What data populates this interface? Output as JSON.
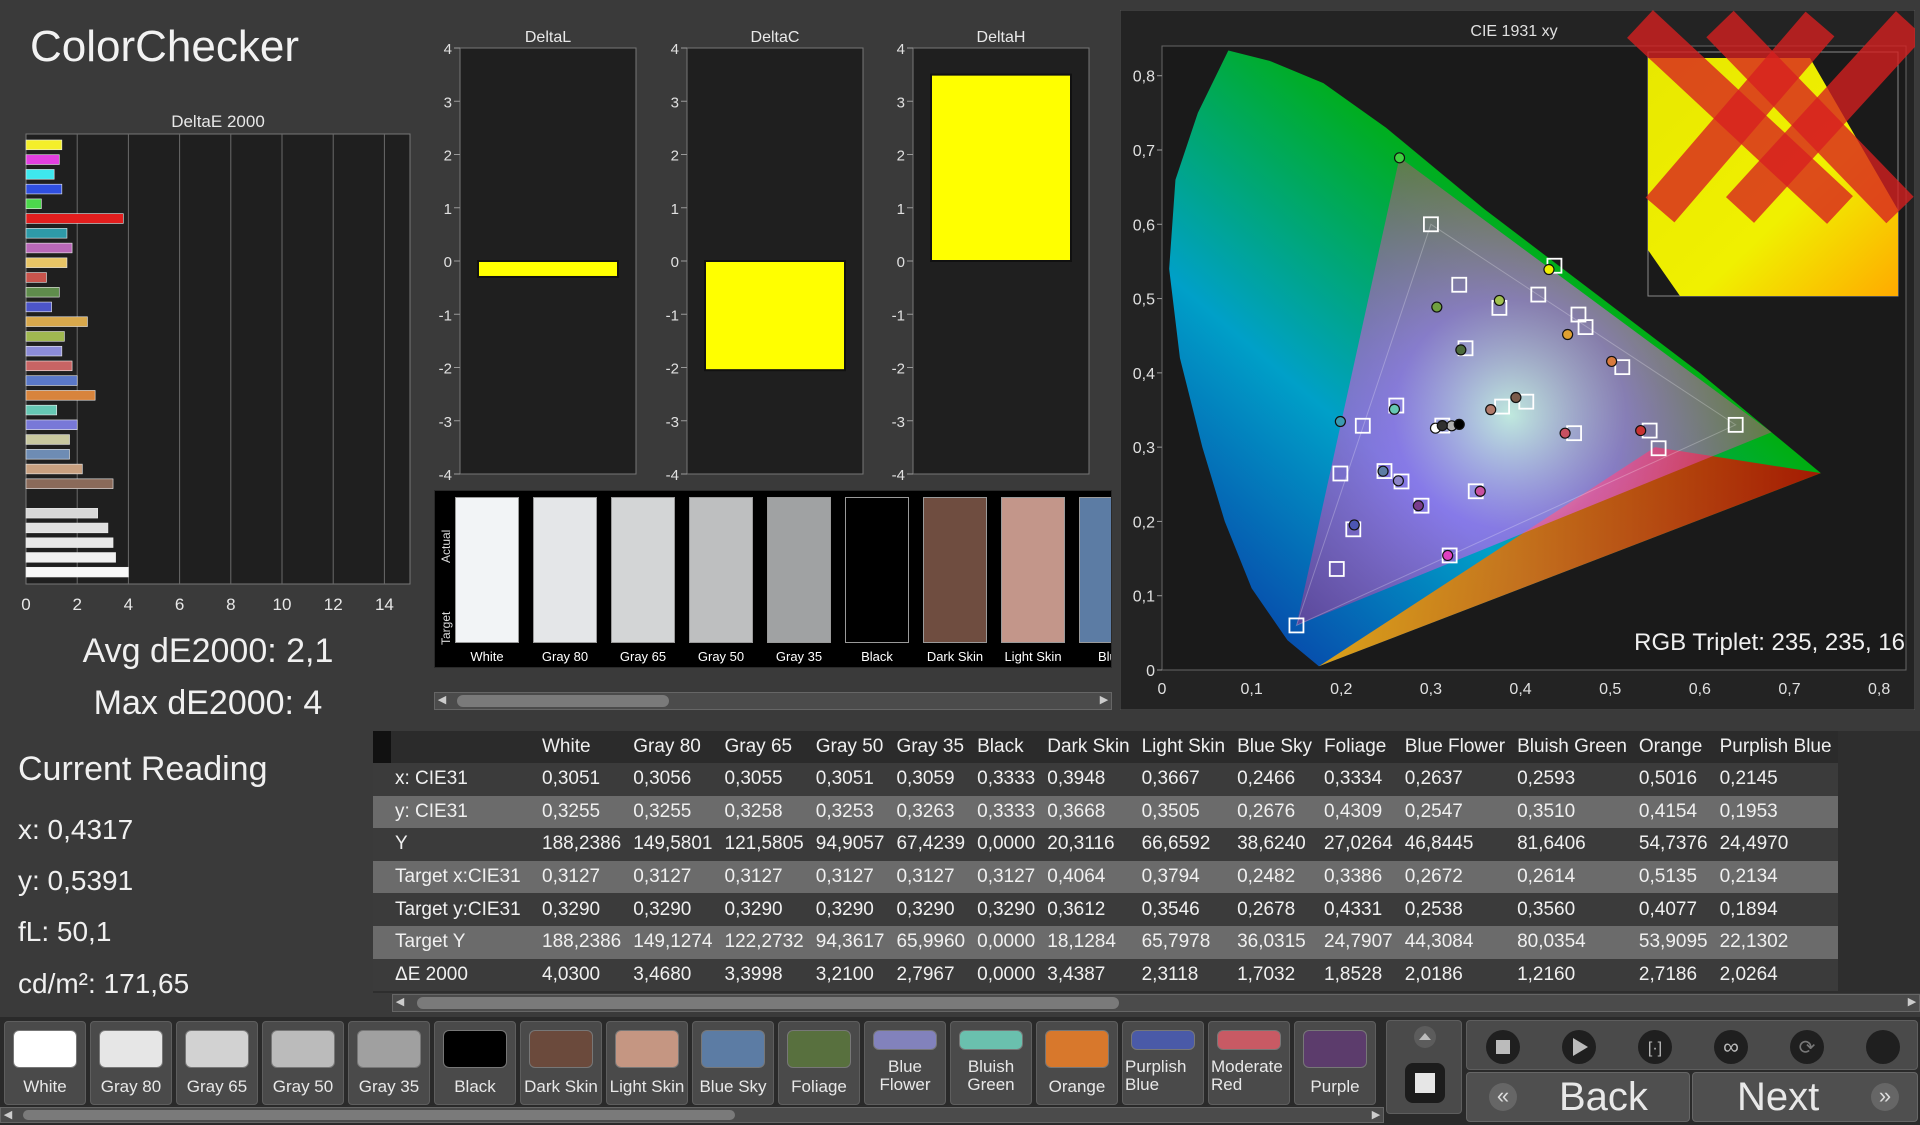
{
  "app": {
    "title": "ColorChecker"
  },
  "deltae_chart": {
    "title": "DeltaE 2000",
    "ticks": [
      "0",
      "2",
      "4",
      "6",
      "8",
      "10",
      "12",
      "14"
    ],
    "xlim": [
      0,
      15
    ],
    "bars": [
      {
        "value": 1.4,
        "color": "#f4ef2a"
      },
      {
        "value": 1.3,
        "color": "#e33fe0"
      },
      {
        "value": 1.1,
        "color": "#3ee8ee"
      },
      {
        "value": 1.4,
        "color": "#2f4fe0"
      },
      {
        "value": 0.6,
        "color": "#4cd84c"
      },
      {
        "value": 3.8,
        "color": "#e31e1e"
      },
      {
        "value": 1.6,
        "color": "#2e9aa8"
      },
      {
        "value": 1.8,
        "color": "#b968b8"
      },
      {
        "value": 1.6,
        "color": "#e8c566"
      },
      {
        "value": 0.8,
        "color": "#c8544c"
      },
      {
        "value": 1.3,
        "color": "#5f8c4c"
      },
      {
        "value": 1.0,
        "color": "#4c55c8"
      },
      {
        "value": 2.4,
        "color": "#d8a84c"
      },
      {
        "value": 1.5,
        "color": "#a0b850"
      },
      {
        "value": 1.4,
        "color": "#8c8cd8"
      },
      {
        "value": 1.8,
        "color": "#c86464"
      },
      {
        "value": 2.0,
        "color": "#5a78c8"
      },
      {
        "value": 2.7,
        "color": "#d8843c"
      },
      {
        "value": 1.2,
        "color": "#66c8b4"
      },
      {
        "value": 2.0,
        "color": "#7878d8"
      },
      {
        "value": 1.7,
        "color": "#c8c8a0"
      },
      {
        "value": 1.7,
        "color": "#6e8cb4"
      },
      {
        "value": 2.2,
        "color": "#c8a080"
      },
      {
        "value": 3.4,
        "color": "#8a6a5a"
      },
      {
        "value": 0.0,
        "color": "#000000"
      },
      {
        "value": 2.8,
        "color": "#d8d8d8"
      },
      {
        "value": 3.2,
        "color": "#e0e0e0"
      },
      {
        "value": 3.4,
        "color": "#e8e8e8"
      },
      {
        "value": 3.5,
        "color": "#f0f0f0"
      },
      {
        "value": 4.0,
        "color": "#f8f8f8"
      }
    ]
  },
  "summary": {
    "avg": "Avg dE2000: 2,1",
    "max": "Max dE2000: 4"
  },
  "current_reading": {
    "title": "Current Reading",
    "x": "x: 0,4317",
    "y": "y: 0,5391",
    "fl": "fL: 50,1",
    "cd": "cd/m²: 171,65"
  },
  "delta_charts": {
    "ticks": [
      "4",
      "3",
      "2",
      "1",
      "0",
      "-1",
      "-2",
      "-3",
      "-4"
    ],
    "ylim": [
      -4,
      4
    ],
    "charts": [
      {
        "title": "DeltaL",
        "value": -0.3
      },
      {
        "title": "DeltaC",
        "value": -2.05
      },
      {
        "title": "DeltaH",
        "value": 3.5
      }
    ],
    "bar_color": "#ffff00"
  },
  "swatch_strip": {
    "actual_label": "Actual",
    "target_label": "Target",
    "items": [
      {
        "name": "White",
        "color": "#f2f4f6"
      },
      {
        "name": "Gray 80",
        "color": "#e4e6e8"
      },
      {
        "name": "Gray 65",
        "color": "#d3d5d6"
      },
      {
        "name": "Gray 50",
        "color": "#bebfc0"
      },
      {
        "name": "Gray 35",
        "color": "#a0a2a3"
      },
      {
        "name": "Black",
        "color": "#000000"
      },
      {
        "name": "Dark Skin",
        "color": "#6f4d40"
      },
      {
        "name": "Light Skin",
        "color": "#c3968a"
      },
      {
        "name": "Blue",
        "color": "#5c7ca4"
      }
    ]
  },
  "cie_chart": {
    "title": "CIE 1931 xy",
    "x_ticks": [
      "0",
      "0,1",
      "0,2",
      "0,3",
      "0,4",
      "0,5",
      "0,6",
      "0,7",
      "0,8"
    ],
    "y_ticks": [
      "0",
      "0,1",
      "0,2",
      "0,3",
      "0,4",
      "0,5",
      "0,6",
      "0,7",
      "0,8"
    ],
    "xlim": [
      0,
      0.83
    ],
    "ylim": [
      0,
      0.84
    ],
    "gamut_target": [
      [
        0.64,
        0.33
      ],
      [
        0.3,
        0.6
      ],
      [
        0.15,
        0.06
      ]
    ],
    "gamut_actual": [
      [
        0.68,
        0.32
      ],
      [
        0.265,
        0.69
      ],
      [
        0.15,
        0.06
      ]
    ],
    "targets": [
      [
        0.3127,
        0.329
      ],
      [
        0.4064,
        0.3612
      ],
      [
        0.3794,
        0.3546
      ],
      [
        0.2482,
        0.2678
      ],
      [
        0.3386,
        0.4331
      ],
      [
        0.2672,
        0.2538
      ],
      [
        0.2614,
        0.356
      ],
      [
        0.5135,
        0.4077
      ],
      [
        0.2134,
        0.1894
      ],
      [
        0.4597,
        0.3188
      ],
      [
        0.3764,
        0.4875
      ],
      [
        0.4725,
        0.4616
      ],
      [
        0.195,
        0.136
      ],
      [
        0.3316,
        0.5186
      ],
      [
        0.544,
        0.3223
      ],
      [
        0.4646,
        0.4785
      ],
      [
        0.35,
        0.2406
      ],
      [
        0.199,
        0.2645
      ],
      [
        0.64,
        0.33
      ],
      [
        0.3,
        0.6
      ],
      [
        0.15,
        0.06
      ],
      [
        0.224,
        0.3288
      ],
      [
        0.3209,
        0.1542
      ],
      [
        0.4198,
        0.5054
      ],
      [
        0.2895,
        0.2212
      ],
      [
        0.4378,
        0.5442
      ],
      [
        0.554,
        0.2985
      ]
    ],
    "actuals": [
      [
        0.3051,
        0.3255,
        "#ffffff"
      ],
      [
        0.3948,
        0.3668,
        "#7a5a4a"
      ],
      [
        0.3667,
        0.3505,
        "#b07a6a"
      ],
      [
        0.2466,
        0.2676,
        "#5c7ca4"
      ],
      [
        0.3334,
        0.4309,
        "#4c6a3c"
      ],
      [
        0.2637,
        0.2547,
        "#8c84c8"
      ],
      [
        0.2593,
        0.351,
        "#66c8b4"
      ],
      [
        0.5016,
        0.4154,
        "#d87a3c"
      ],
      [
        0.2145,
        0.1953,
        "#4c56b4"
      ],
      [
        0.4497,
        0.3188,
        "#c85060"
      ],
      [
        0.3764,
        0.4975,
        "#a0c050"
      ],
      [
        0.4525,
        0.4516,
        "#e0a030"
      ],
      [
        0.286,
        0.2212,
        "#7a3c8c"
      ],
      [
        0.3066,
        0.4886,
        "#70a040"
      ],
      [
        0.534,
        0.3223,
        "#c83232"
      ],
      [
        0.3232,
        0.3287,
        "#b0b0b0"
      ],
      [
        0.355,
        0.2406,
        "#c850a0"
      ],
      [
        0.199,
        0.3345,
        "#3a9ab0"
      ],
      [
        0.3127,
        0.329,
        "#303030"
      ],
      [
        0.3316,
        0.3306,
        "#000000"
      ],
      [
        0.3187,
        0.1542,
        "#e040c0"
      ],
      [
        0.265,
        0.6895,
        "#40d040"
      ],
      [
        0.4317,
        0.5391,
        "#f0f000"
      ]
    ],
    "rgb_triplet": "RGB Triplet: 235, 235, 16",
    "inset_color": "#f0f000"
  },
  "table": {
    "columns": [
      "",
      "White",
      "Gray 80",
      "Gray 65",
      "Gray 50",
      "Gray 35",
      "Black",
      "Dark Skin",
      "Light Skin",
      "Blue Sky",
      "Foliage",
      "Blue Flower",
      "Bluish Green",
      "Orange",
      "Purplish Blue"
    ],
    "rows": [
      {
        "label": "x: CIE31",
        "cells": [
          "0,3051",
          "0,3056",
          "0,3055",
          "0,3051",
          "0,3059",
          "0,3333",
          "0,3948",
          "0,3667",
          "0,2466",
          "0,3334",
          "0,2637",
          "0,2593",
          "0,5016",
          "0,2145"
        ]
      },
      {
        "label": "y: CIE31",
        "cells": [
          "0,3255",
          "0,3255",
          "0,3258",
          "0,3253",
          "0,3263",
          "0,3333",
          "0,3668",
          "0,3505",
          "0,2676",
          "0,4309",
          "0,2547",
          "0,3510",
          "0,4154",
          "0,1953"
        ]
      },
      {
        "label": "Y",
        "cells": [
          "188,2386",
          "149,5801",
          "121,5805",
          "94,9057",
          "67,4239",
          "0,0000",
          "20,3116",
          "66,6592",
          "38,6240",
          "27,0264",
          "46,8445",
          "81,6406",
          "54,7376",
          "24,4970"
        ]
      },
      {
        "label": "Target x:CIE31",
        "cells": [
          "0,3127",
          "0,3127",
          "0,3127",
          "0,3127",
          "0,3127",
          "0,3127",
          "0,4064",
          "0,3794",
          "0,2482",
          "0,3386",
          "0,2672",
          "0,2614",
          "0,5135",
          "0,2134"
        ]
      },
      {
        "label": "Target y:CIE31",
        "cells": [
          "0,3290",
          "0,3290",
          "0,3290",
          "0,3290",
          "0,3290",
          "0,3290",
          "0,3612",
          "0,3546",
          "0,2678",
          "0,4331",
          "0,2538",
          "0,3560",
          "0,4077",
          "0,1894"
        ]
      },
      {
        "label": "Target Y",
        "cells": [
          "188,2386",
          "149,1274",
          "122,2732",
          "94,3617",
          "65,9960",
          "0,0000",
          "18,1284",
          "65,7978",
          "36,0315",
          "24,7907",
          "44,3084",
          "80,0354",
          "53,9095",
          "22,1302"
        ]
      },
      {
        "label": "ΔE 2000",
        "cells": [
          "4,0300",
          "3,4680",
          "3,3998",
          "3,2100",
          "2,7967",
          "0,0000",
          "3,4387",
          "2,3118",
          "1,7032",
          "1,8528",
          "2,0186",
          "1,2160",
          "2,7186",
          "2,0264"
        ]
      }
    ]
  },
  "bottom_swatches": [
    {
      "name": "White",
      "lines": [
        "White"
      ],
      "color": "#ffffff"
    },
    {
      "name": "Gray 80",
      "lines": [
        "Gray 80"
      ],
      "color": "#e6e6e6"
    },
    {
      "name": "Gray 65",
      "lines": [
        "Gray 65"
      ],
      "color": "#d2d2d2"
    },
    {
      "name": "Gray 50",
      "lines": [
        "Gray 50"
      ],
      "color": "#bbbbbb"
    },
    {
      "name": "Gray 35",
      "lines": [
        "Gray 35"
      ],
      "color": "#a0a0a0"
    },
    {
      "name": "Black",
      "lines": [
        "Black"
      ],
      "color": "#000000"
    },
    {
      "name": "Dark Skin",
      "lines": [
        "Dark Skin"
      ],
      "color": "#6b4a3c"
    },
    {
      "name": "Light Skin",
      "lines": [
        "Light Skin"
      ],
      "color": "#c59682"
    },
    {
      "name": "Blue Sky",
      "lines": [
        "Blue Sky"
      ],
      "color": "#5c7ca4"
    },
    {
      "name": "Foliage",
      "lines": [
        "Foliage"
      ],
      "color": "#58703e"
    },
    {
      "name": "Blue Flower",
      "lines": [
        "Blue",
        "Flower"
      ],
      "color": "#8282bc"
    },
    {
      "name": "Bluish Green",
      "lines": [
        "Bluish",
        "Green"
      ],
      "color": "#6ac0ae"
    },
    {
      "name": "Orange",
      "lines": [
        "Orange"
      ],
      "color": "#d8782c"
    },
    {
      "name": "Purplish Blue",
      "lines": [
        "Purplish",
        "Blue"
      ],
      "color": "#4a5aa8"
    },
    {
      "name": "Moderate Red",
      "lines": [
        "Moderate",
        "Red"
      ],
      "color": "#c85a64"
    },
    {
      "name": "Purple",
      "lines": [
        "Purple"
      ],
      "color": "#5c3c6c"
    }
  ],
  "nav": {
    "back": "Back",
    "next": "Next"
  }
}
